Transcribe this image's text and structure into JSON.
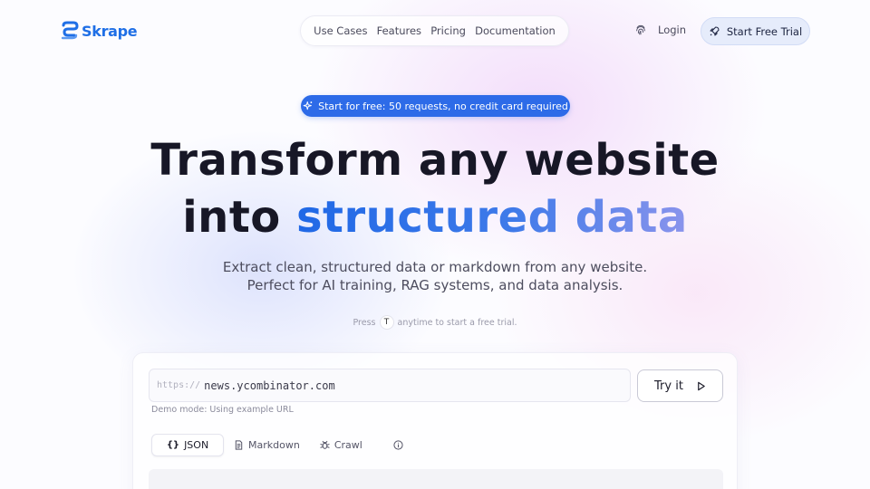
{
  "brand": {
    "name": "Skrape",
    "color": "#1f6fe6"
  },
  "nav": {
    "items": [
      {
        "label": "Use Cases"
      },
      {
        "label": "Features"
      },
      {
        "label": "Pricing"
      },
      {
        "label": "Documentation"
      }
    ]
  },
  "header": {
    "login_label": "Login",
    "trial_label": "Start Free Trial",
    "login_icon": "fingerprint-icon",
    "trial_icon": "rocket-icon"
  },
  "hero": {
    "badge": "Start for free: 50 requests, no credit card required",
    "badge_icon": "sparkle-icon",
    "headline_line1": "Transform any website",
    "headline_line2_prefix": "into ",
    "headline_line2_highlight": "structured data",
    "subtitle_line1": "Extract clean, structured data or markdown from any website.",
    "subtitle_line2": "Perfect for AI training, RAG systems, and data analysis.",
    "hint_before": "Press",
    "hint_key": "T",
    "hint_after": "anytime to start a free trial."
  },
  "demo": {
    "url_prefix": "https://",
    "url_value": "news.ycombinator.com",
    "try_label": "Try it",
    "demo_mode": "Demo mode: Using example URL",
    "tabs": [
      {
        "label": "JSON",
        "icon": "braces-icon",
        "active": true
      },
      {
        "label": "Markdown",
        "icon": "document-icon",
        "active": false
      },
      {
        "label": "Crawl",
        "icon": "bug-icon",
        "active": false
      }
    ],
    "info_icon": "info-icon"
  },
  "colors": {
    "accent": "#2d6be8",
    "text": "#171726",
    "muted": "#4d4d5e"
  }
}
